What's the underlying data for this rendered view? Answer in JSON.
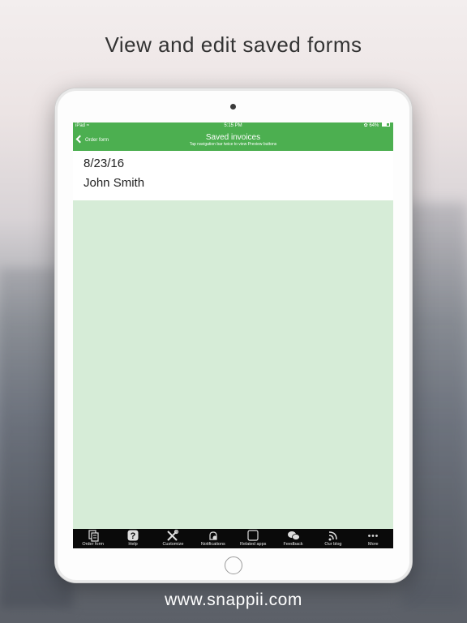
{
  "promo": {
    "headline": "View and edit saved forms",
    "footer_url": "www.snappii.com"
  },
  "status_bar": {
    "device": "iPad",
    "time": "5:15 PM",
    "battery": "64%"
  },
  "nav_bar": {
    "back_label": "Order form",
    "title": "Saved invoices",
    "subtitle": "Tap navigation bar twice to view Preview buttons"
  },
  "saved_items": [
    {
      "date": "8/23/16",
      "name": "John Smith"
    }
  ],
  "tab_bar": [
    {
      "label": "Order form",
      "icon": "order-form-icon"
    },
    {
      "label": "Help",
      "icon": "help-icon"
    },
    {
      "label": "Customize",
      "icon": "tools-icon"
    },
    {
      "label": "Notifications",
      "icon": "notifications-icon"
    },
    {
      "label": "Related apps",
      "icon": "related-apps-icon"
    },
    {
      "label": "Feedback",
      "icon": "feedback-icon"
    },
    {
      "label": "Our blog",
      "icon": "rss-icon"
    },
    {
      "label": "More",
      "icon": "more-icon"
    }
  ],
  "colors": {
    "accent_green": "#4caf50",
    "content_background": "#d6ecd7",
    "tab_bar": "#0a0a0a"
  }
}
